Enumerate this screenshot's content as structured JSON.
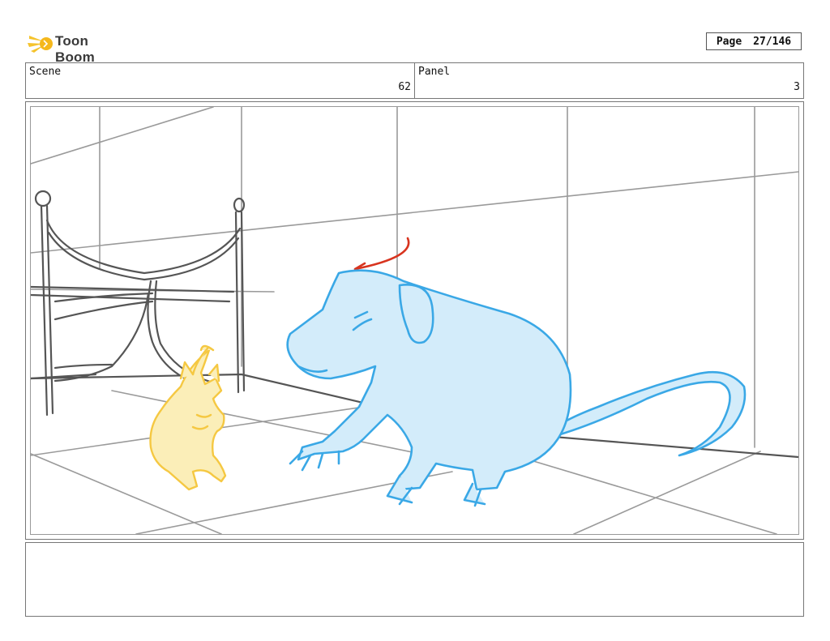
{
  "header": {
    "logo_text": "Toon Boom",
    "page_label": "Page",
    "page_value": "27/146"
  },
  "info": {
    "scene_label": "Scene",
    "scene_value": "62",
    "panel_label": "Panel",
    "panel_value": "3"
  },
  "drawing": {
    "background_color": "#9a9a9a",
    "kitten_color": "#f5c842",
    "rat_color": "#3aa8e6",
    "rat_fill": "#d3ecfa",
    "arrow_color": "#d8341f"
  },
  "notes": {
    "text": ""
  }
}
